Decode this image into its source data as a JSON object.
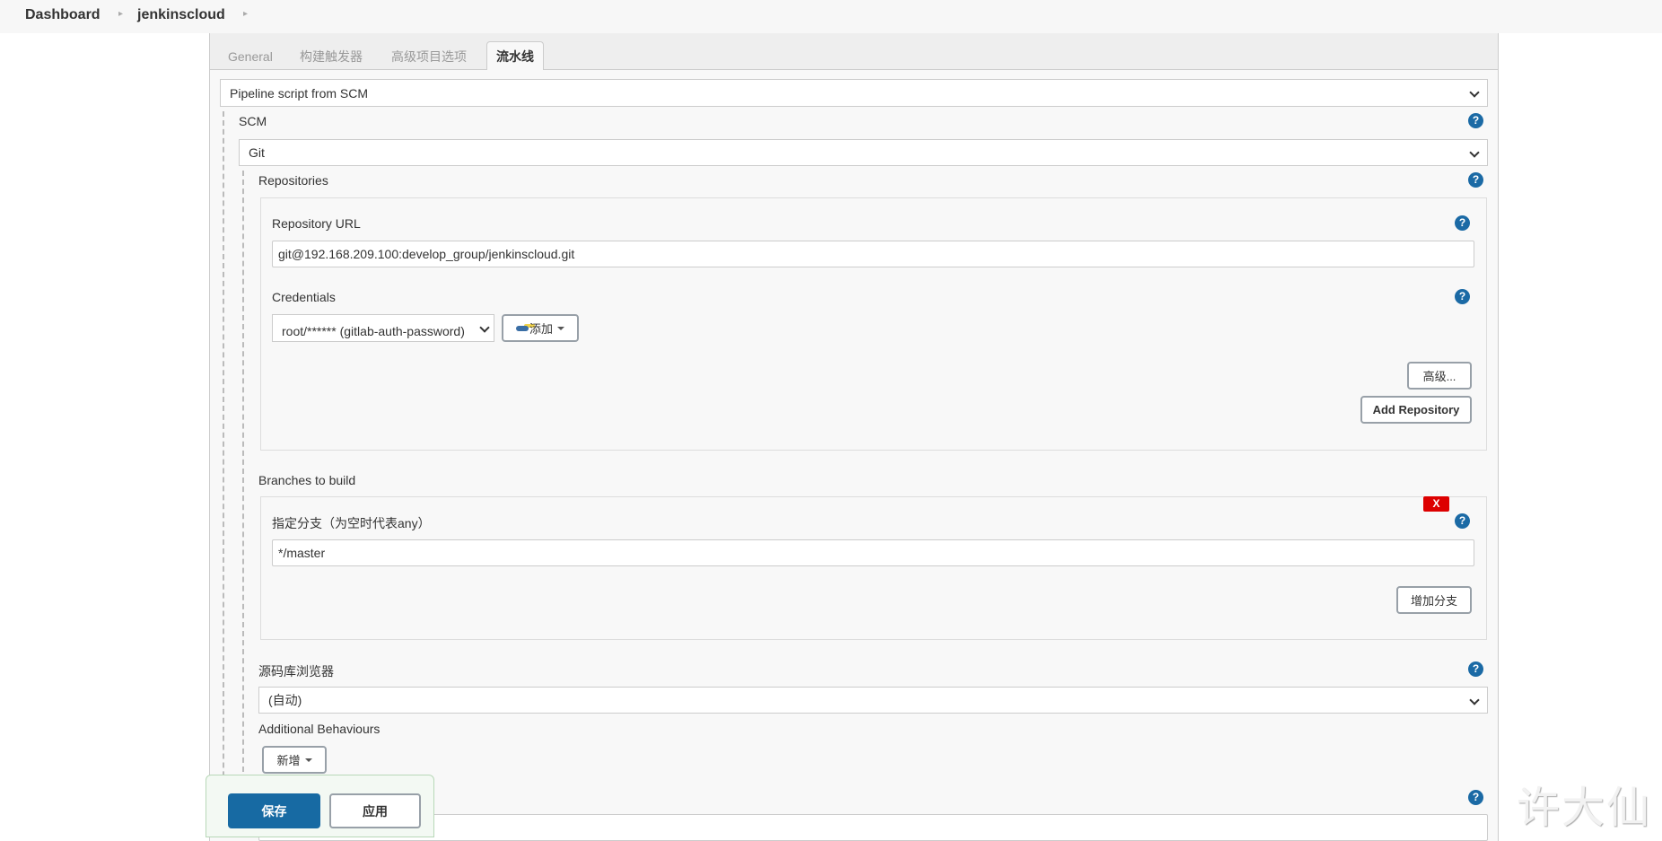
{
  "breadcrumb": {
    "items": [
      "Dashboard",
      "jenkinscloud"
    ],
    "separator_icon": "chevron-right-icon"
  },
  "tabs": [
    {
      "label": "General",
      "active": false
    },
    {
      "label": "构建触发器",
      "active": false
    },
    {
      "label": "高级项目选项",
      "active": false
    },
    {
      "label": "流水线",
      "active": true
    }
  ],
  "pipeline": {
    "definition_value": "Pipeline script from SCM",
    "scm": {
      "label": "SCM",
      "value": "Git"
    },
    "repositories": {
      "label": "Repositories",
      "repository_url_label": "Repository URL",
      "repository_url_value": "git@192.168.209.100:develop_group/jenkinscloud.git",
      "credentials_label": "Credentials",
      "credentials_value": "root/****** (gitlab-auth-password)",
      "add_credentials_label": "添加",
      "advanced_label": "高级...",
      "add_repository_label": "Add Repository"
    },
    "branches": {
      "label": "Branches to build",
      "delete_label": "X",
      "branch_specifier_label": "指定分支（为空时代表any）",
      "branch_specifier_value": "*/master",
      "add_branch_label": "增加分支"
    },
    "repo_browser": {
      "label": "源码库浏览器",
      "value": "(自动)"
    },
    "additional_behaviours": {
      "label": "Additional Behaviours",
      "add_label": "新增"
    }
  },
  "actions": {
    "save_label": "保存",
    "apply_label": "应用"
  },
  "help_icon_glyph": "?",
  "watermark": "许大仙",
  "colors": {
    "primary": "#176aa3",
    "help": "#1b6aa5",
    "danger": "#dd0000"
  }
}
